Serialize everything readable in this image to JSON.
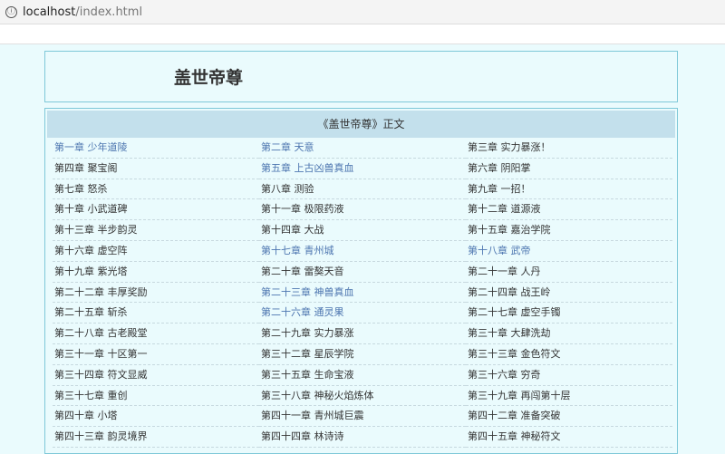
{
  "browser": {
    "url_host": "localhost",
    "url_path": "/index.html",
    "info_icon": "ⓘ"
  },
  "header": {
    "title": "盖世帝尊"
  },
  "list": {
    "heading": "《盖世帝尊》正文",
    "chapters": [
      {
        "label": "第一章  少年道陵",
        "visited": true
      },
      {
        "label": "第二章  天意",
        "visited": true
      },
      {
        "label": "第三章  实力暴涨！",
        "visited": false
      },
      {
        "label": "第四章  聚宝阁",
        "visited": false
      },
      {
        "label": "第五章  上古凶兽真血",
        "visited": true
      },
      {
        "label": "第六章  阴阳掌",
        "visited": false
      },
      {
        "label": "第七章  怒杀",
        "visited": false
      },
      {
        "label": "第八章  测验",
        "visited": false
      },
      {
        "label": "第九章  一招！",
        "visited": false
      },
      {
        "label": "第十章  小武道碑",
        "visited": false
      },
      {
        "label": "第十一章  极限药液",
        "visited": false
      },
      {
        "label": "第十二章  道源液",
        "visited": false
      },
      {
        "label": "第十三章  半步韵灵",
        "visited": false
      },
      {
        "label": "第十四章  大战",
        "visited": false
      },
      {
        "label": "第十五章  嘉治学院",
        "visited": false
      },
      {
        "label": "第十六章  虚空阵",
        "visited": false
      },
      {
        "label": "第十七章  青州城",
        "visited": true
      },
      {
        "label": "第十八章  武帝",
        "visited": true
      },
      {
        "label": "第十九章  紫光塔",
        "visited": false
      },
      {
        "label": "第二十章  雷獒天音",
        "visited": false
      },
      {
        "label": "第二十一章  人丹",
        "visited": false
      },
      {
        "label": "第二十二章  丰厚奖励",
        "visited": false
      },
      {
        "label": "第二十三章  神兽真血",
        "visited": true
      },
      {
        "label": "第二十四章  战王岭",
        "visited": false
      },
      {
        "label": "第二十五章  斩杀",
        "visited": false
      },
      {
        "label": "第二十六章  通灵果",
        "visited": true
      },
      {
        "label": "第二十七章  虚空手镯",
        "visited": false
      },
      {
        "label": "第二十八章  古老殿堂",
        "visited": false
      },
      {
        "label": "第二十九章  实力暴涨",
        "visited": false
      },
      {
        "label": "第三十章  大肆洗劫",
        "visited": false
      },
      {
        "label": "第三十一章  十区第一",
        "visited": false
      },
      {
        "label": "第三十二章  星辰学院",
        "visited": false
      },
      {
        "label": "第三十三章  金色符文",
        "visited": false
      },
      {
        "label": "第三十四章  符文显威",
        "visited": false
      },
      {
        "label": "第三十五章  生命宝液",
        "visited": false
      },
      {
        "label": "第三十六章  穷奇",
        "visited": false
      },
      {
        "label": "第三十七章  重创",
        "visited": false
      },
      {
        "label": "第三十八章  神秘火焰炼体",
        "visited": false
      },
      {
        "label": "第三十九章  再闯第十层",
        "visited": false
      },
      {
        "label": "第四十章  小塔",
        "visited": false
      },
      {
        "label": "第四十一章  青州城巨震",
        "visited": false
      },
      {
        "label": "第四十二章  准备突破",
        "visited": false
      },
      {
        "label": "第四十三章  韵灵境界",
        "visited": false
      },
      {
        "label": "第四十四章  林诗诗",
        "visited": false
      },
      {
        "label": "第四十五章  神秘符文",
        "visited": false
      }
    ]
  },
  "colors": {
    "page_bg": "#eafbfd",
    "border": "#7ec8d8",
    "heading_bg": "#c3e0ec",
    "link": "#333333",
    "visited_link": "#4d76b0"
  }
}
